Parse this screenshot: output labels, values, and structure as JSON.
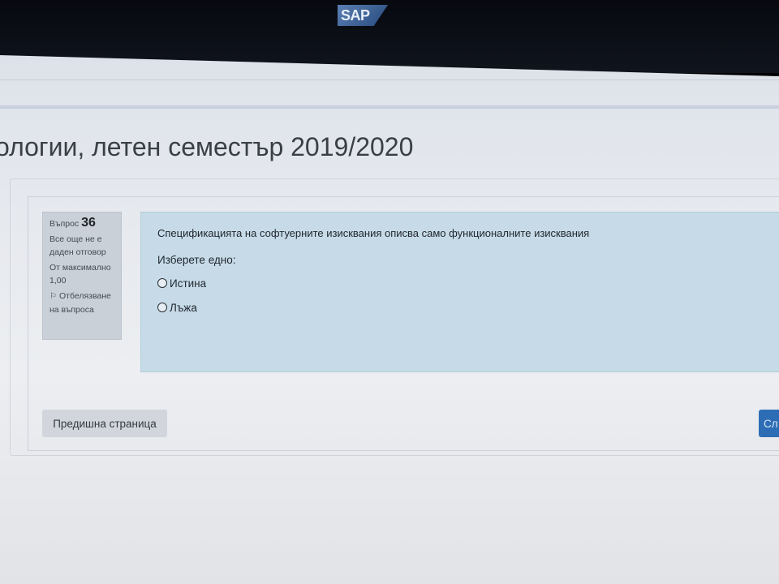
{
  "bezel": {
    "brand": "SAP"
  },
  "page": {
    "title": "ологии, летен семестър 2019/2020"
  },
  "question_info": {
    "label": "Въпрос",
    "number": "36",
    "status": "Все още не е даден отговор",
    "marks": "От максимално 1,00",
    "flag_label": "Отбелязване на въпроса",
    "flag_icon": "flag-icon"
  },
  "question": {
    "text": "Спецификацията на софтуерните изисквания описва само функционалните изисквания",
    "prompt": "Изберете едно:",
    "answers": [
      {
        "label": "Истина"
      },
      {
        "label": "Лъжа"
      }
    ]
  },
  "navigation": {
    "prev_label": "Предишна страница",
    "next_label": "Сл"
  },
  "colors": {
    "formulation_bg": "#c6dbe7",
    "info_bg": "#c9d0d8",
    "next_button": "#2d6db5"
  }
}
